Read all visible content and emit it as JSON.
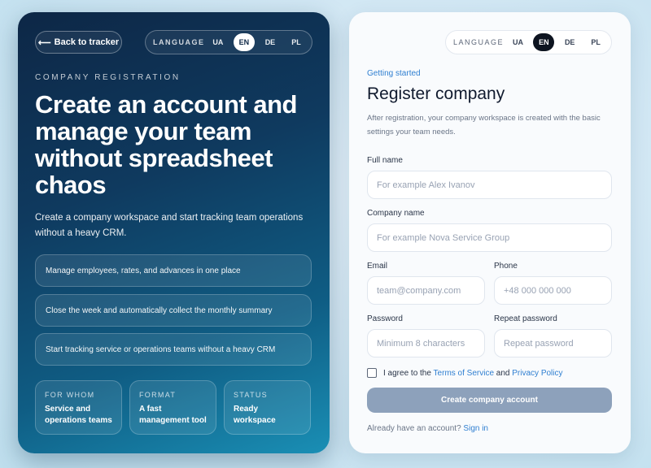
{
  "left": {
    "back_label": "Back to tracker",
    "language": {
      "label": "LANGUAGE",
      "options": [
        "UA",
        "EN",
        "DE",
        "PL"
      ],
      "active": "EN"
    },
    "eyebrow": "COMPANY REGISTRATION",
    "headline": "Create an account and manage your team without spreadsheet chaos",
    "subtitle": "Create a company workspace and start tracking team operations without a heavy CRM.",
    "features": [
      "Manage employees, rates, and advances in one place",
      "Close the week and automatically collect the monthly summary",
      "Start tracking service or operations teams without a heavy CRM"
    ],
    "cards": [
      {
        "key": "FOR WHOM",
        "value": "Service and operations teams"
      },
      {
        "key": "FORMAT",
        "value": "A fast management tool"
      },
      {
        "key": "STATUS",
        "value": "Ready workspace"
      }
    ]
  },
  "form": {
    "language": {
      "label": "LANGUAGE",
      "options": [
        "UA",
        "EN",
        "DE",
        "PL"
      ],
      "active": "EN"
    },
    "kicker": "Getting started",
    "title": "Register company",
    "description": "After registration, your company workspace is created with the basic settings your team needs.",
    "fields": {
      "full_name": {
        "label": "Full name",
        "placeholder": "For example Alex Ivanov"
      },
      "company_name": {
        "label": "Company name",
        "placeholder": "For example Nova Service Group"
      },
      "email": {
        "label": "Email",
        "placeholder": "team@company.com"
      },
      "phone": {
        "label": "Phone",
        "placeholder": "+48 000 000 000"
      },
      "password": {
        "label": "Password",
        "placeholder": "Minimum 8 characters"
      },
      "repeat_password": {
        "label": "Repeat password",
        "placeholder": "Repeat password"
      }
    },
    "agree": {
      "prefix": "I agree to the",
      "terms": "Terms of Service",
      "and": "and",
      "privacy": "Privacy Policy"
    },
    "submit_label": "Create company account",
    "signin": {
      "prompt": "Already have an account?",
      "link": "Sign in"
    }
  },
  "colors": {
    "accent_link": "#2f7fd1",
    "button_disabled": "#8da1bb",
    "panel_dark": "#0f3a5f"
  },
  "icons": {
    "back": "arrow-left-icon"
  }
}
